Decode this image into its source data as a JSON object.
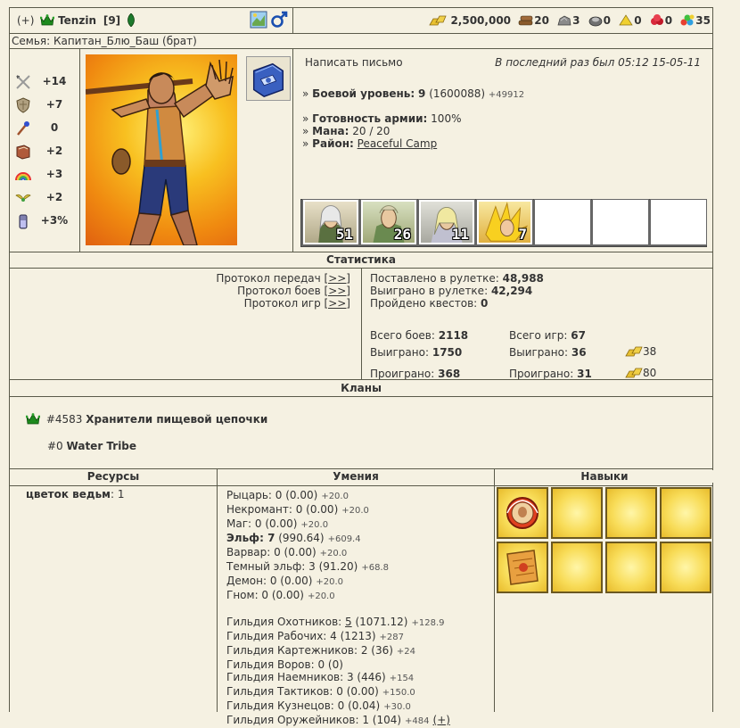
{
  "header": {
    "plus_label": "(+)",
    "name": "Tenzin",
    "level": "[9]",
    "gold": "2,500,000",
    "resources": [
      {
        "icon": "wood-icon",
        "value": "20"
      },
      {
        "icon": "ore-icon",
        "value": "3"
      },
      {
        "icon": "mercury-icon",
        "value": "0"
      },
      {
        "icon": "sulfur-icon",
        "value": "0"
      },
      {
        "icon": "crystal-icon",
        "value": "0"
      },
      {
        "icon": "gems-icon",
        "value": "35"
      }
    ]
  },
  "family": "Семья: Капитан_Блю_Баш (брат)",
  "stats": [
    {
      "icon": "attack-sword-icon",
      "value": "+14"
    },
    {
      "icon": "defense-shield-icon",
      "value": "+7"
    },
    {
      "icon": "spellpower-wand-icon",
      "value": "0"
    },
    {
      "icon": "knowledge-book-icon",
      "value": "+2"
    },
    {
      "icon": "luck-rainbow-icon",
      "value": "+3"
    },
    {
      "icon": "morale-wings-icon",
      "value": "+2"
    },
    {
      "icon": "initiative-potion-icon",
      "value": "+3%"
    }
  ],
  "info": {
    "write_letter": "Написать письмо",
    "last_seen": "В последний раз был 05:12 15-05-11",
    "combat_level_label": "Боевой уровень:",
    "combat_level": "9",
    "combat_exp": "(1600088)",
    "combat_exp_plus": "+49912",
    "army_ready_label": "Готовность армии:",
    "army_ready": "100%",
    "mana_label": "Мана:",
    "mana": "20 / 20",
    "district_label": "Район:",
    "district": "Peaceful Camp",
    "bullet": "»"
  },
  "army": [
    "51",
    "26",
    "11",
    "7",
    "",
    "",
    ""
  ],
  "statistics": {
    "title": "Статистика",
    "protocols": [
      {
        "label": "Протокол передач",
        "link": "[>>]"
      },
      {
        "label": "Протокол боев",
        "link": "[>>]"
      },
      {
        "label": "Протокол игр",
        "link": "[>>]"
      }
    ],
    "roulette_bet_label": "Поставлено в рулетке:",
    "roulette_bet": "48,988",
    "roulette_won_label": "Выиграно в рулетке:",
    "roulette_won": "42,294",
    "quests_label": "Пройдено квестов:",
    "quests": "0",
    "battles_total_label": "Всего боев:",
    "battles_total": "2118",
    "battles_won_label": "Выиграно:",
    "battles_won": "1750",
    "battles_lost_label": "Проиграно:",
    "battles_lost": "368",
    "games_total_label": "Всего игр:",
    "games_total": "67",
    "games_won_label": "Выиграно:",
    "games_won": "36",
    "games_won_gold": "38",
    "games_lost_label": "Проиграно:",
    "games_lost": "31",
    "games_lost_gold": "80"
  },
  "clans": {
    "title": "Кланы",
    "items": [
      {
        "id": "#4583",
        "name": "Хранители пищевой цепочки"
      },
      {
        "id": "#0",
        "name": "Water Tribe"
      }
    ]
  },
  "resources_col": {
    "title": "Ресурсы",
    "item_name": "цветок ведьм",
    "item_count": ": 1"
  },
  "abilities": {
    "title": "Умения",
    "races": [
      {
        "name": "Рыцарь",
        "value": ": 0 (0.00)",
        "plus": "+20.0",
        "bold": false
      },
      {
        "name": "Некромант",
        "value": ": 0 (0.00)",
        "plus": "+20.0",
        "bold": false
      },
      {
        "name": "Маг",
        "value": ": 0 (0.00)",
        "plus": "+20.0",
        "bold": false
      },
      {
        "name": "Эльф: 7",
        "value": " (990.64)",
        "plus": "+609.4",
        "bold": true
      },
      {
        "name": "Варвар",
        "value": ": 0 (0.00)",
        "plus": "+20.0",
        "bold": false
      },
      {
        "name": "Темный эльф",
        "value": ": 3 (91.20)",
        "plus": "+68.8",
        "bold": false
      },
      {
        "name": "Демон",
        "value": ": 0 (0.00)",
        "plus": "+20.0",
        "bold": false
      },
      {
        "name": "Гном",
        "value": ": 0 (0.00)",
        "plus": "+20.0",
        "bold": false
      }
    ],
    "guilds": [
      {
        "name": "Гильдия Охотников: ",
        "level": "5",
        "rest": " (1071.12)",
        "plus": "+128.9",
        "link_level": true
      },
      {
        "name": "Гильдия Рабочих: ",
        "level": "4",
        "rest": " (1213)",
        "plus": "+287",
        "link_level": false
      },
      {
        "name": "Гильдия Картежников: ",
        "level": "2",
        "rest": " (36)",
        "plus": "+24",
        "link_level": false
      },
      {
        "name": "Гильдия Воров: ",
        "level": "0",
        "rest": " (0)",
        "plus": "",
        "link_level": false
      },
      {
        "name": "Гильдия Наемников: ",
        "level": "3",
        "rest": " (446)",
        "plus": "+154",
        "link_level": false
      },
      {
        "name": "Гильдия Тактиков: ",
        "level": "0",
        "rest": " (0.00)",
        "plus": "+150.0",
        "link_level": false
      },
      {
        "name": "Гильдия Кузнецов: ",
        "level": "0",
        "rest": " (0.04)",
        "plus": "+30.0",
        "link_level": false
      },
      {
        "name": "Гильдия Оружейников: ",
        "level": "1",
        "rest": " (104)",
        "plus": "+484",
        "link_level": false,
        "extra": "(+)"
      }
    ]
  },
  "skills": {
    "title": "Навыки"
  },
  "colors": {
    "background": "#f5f1e2",
    "border": "#5a5a4a",
    "gold": "#e8c030",
    "male": "#1a4fb0",
    "crown_green": "#1d8a1d"
  }
}
